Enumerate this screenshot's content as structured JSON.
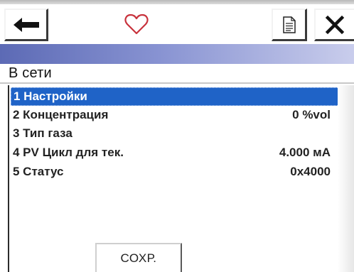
{
  "toolbar": {
    "back_icon": "arrow-left-icon",
    "favorite_icon": "heart-outline-icon",
    "document_icon": "document-icon",
    "close_icon": "close-icon"
  },
  "header": {
    "title": "В сети"
  },
  "menu": {
    "items": [
      {
        "label": "1 Настройки",
        "value": "",
        "selected": true
      },
      {
        "label": "2 Концентрация",
        "value": "0 %vol",
        "selected": false
      },
      {
        "label": "3 Тип газа",
        "value": "",
        "selected": false
      },
      {
        "label": "4 PV Цикл для тек.",
        "value": "4.000 мА",
        "selected": false
      },
      {
        "label": "5 Статус",
        "value": "0x4000",
        "selected": false
      }
    ]
  },
  "footer": {
    "save_label": "СОХР."
  },
  "colors": {
    "selection": "#1f63c7",
    "title_bar_start": "#5c6ab5",
    "title_bar_end": "#c9cdec",
    "heart": "#c8323c"
  }
}
